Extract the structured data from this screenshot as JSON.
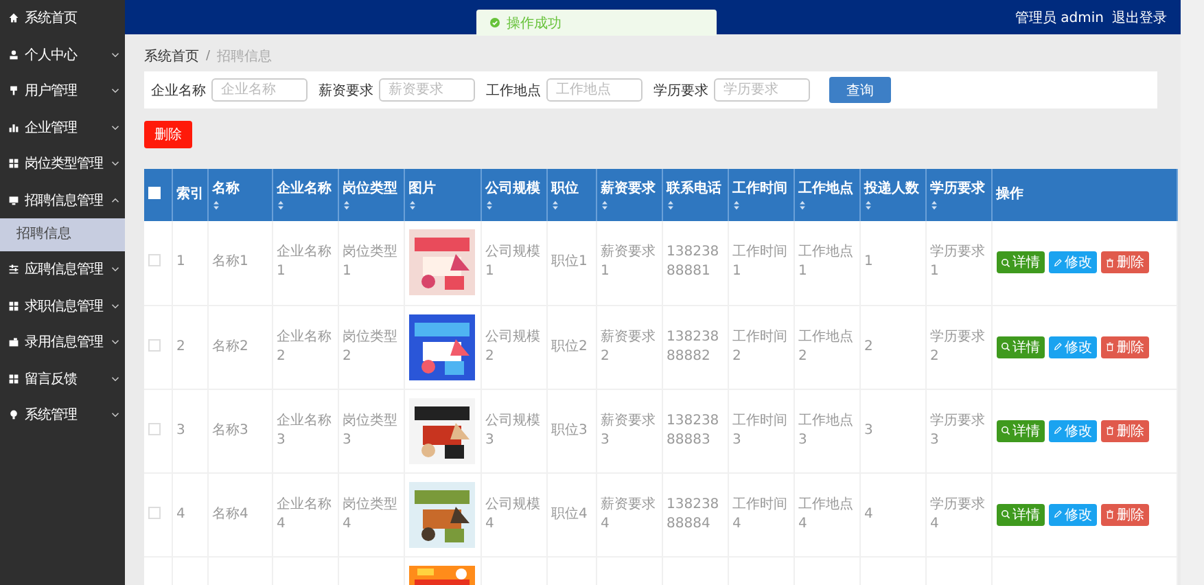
{
  "sidebar": {
    "items": [
      {
        "label": "系统首页"
      },
      {
        "label": "个人中心",
        "expanded": false
      },
      {
        "label": "用户管理",
        "expanded": false
      },
      {
        "label": "企业管理",
        "expanded": false
      },
      {
        "label": "岗位类型管理",
        "expanded": false
      },
      {
        "label": "招聘信息管理",
        "expanded": true,
        "children": [
          {
            "label": "招聘信息",
            "selected": true
          }
        ]
      },
      {
        "label": "应聘信息管理",
        "expanded": false
      },
      {
        "label": "求职信息管理",
        "expanded": false
      },
      {
        "label": "录用信息管理",
        "expanded": false
      },
      {
        "label": "留言反馈",
        "expanded": false
      },
      {
        "label": "系统管理",
        "expanded": false
      }
    ]
  },
  "header": {
    "user": "管理员 admin",
    "logout": "退出登录"
  },
  "toast": {
    "message": "操作成功"
  },
  "breadcrumb": {
    "items": [
      "系统首页",
      "招聘信息"
    ],
    "separator": "/"
  },
  "search": {
    "fields": [
      {
        "label": "企业名称",
        "placeholder": "企业名称"
      },
      {
        "label": "薪资要求",
        "placeholder": "薪资要求"
      },
      {
        "label": "工作地点",
        "placeholder": "工作地点"
      },
      {
        "label": "学历要求",
        "placeholder": "学历要求"
      }
    ],
    "button": "查询"
  },
  "delete_button": "删除",
  "table": {
    "select_all_checked": false,
    "columns": [
      {
        "label": "索引",
        "sortable": false
      },
      {
        "label": "名称",
        "sortable": true
      },
      {
        "label": "企业名称",
        "sortable": true
      },
      {
        "label": "岗位类型",
        "sortable": true
      },
      {
        "label": "图片",
        "sortable": true
      },
      {
        "label": "公司规模",
        "sortable": true
      },
      {
        "label": "职位",
        "sortable": true
      },
      {
        "label": "薪资要求",
        "sortable": true
      },
      {
        "label": "联系电话",
        "sortable": true
      },
      {
        "label": "工作时间",
        "sortable": true
      },
      {
        "label": "工作地点",
        "sortable": true
      },
      {
        "label": "投递人数",
        "sortable": true
      },
      {
        "label": "学历要求",
        "sortable": true
      },
      {
        "label": "操作",
        "sortable": false
      }
    ],
    "rows": [
      {
        "kind": "full",
        "checked": false,
        "cells": [
          "1",
          "名称1",
          "企业名称1",
          "岗位类型1",
          null,
          "公司规模1",
          "职位1",
          "薪资要求1",
          "13823888881",
          "工作时间1",
          "工作地点1",
          "1",
          "学历要求1"
        ],
        "actions": [
          {
            "kind": "detail",
            "label": "详情"
          },
          {
            "kind": "edit",
            "label": "修改"
          },
          {
            "kind": "delete",
            "label": "删除"
          }
        ]
      },
      {
        "kind": "full",
        "checked": false,
        "cells": [
          "2",
          "名称2",
          "企业名称2",
          "岗位类型2",
          null,
          "公司规模2",
          "职位2",
          "薪资要求2",
          "13823888882",
          "工作时间2",
          "工作地点2",
          "2",
          "学历要求2"
        ],
        "actions": [
          {
            "kind": "detail",
            "label": "详情"
          },
          {
            "kind": "edit",
            "label": "修改"
          },
          {
            "kind": "delete",
            "label": "删除"
          }
        ]
      },
      {
        "kind": "full",
        "checked": false,
        "cells": [
          "3",
          "名称3",
          "企业名称3",
          "岗位类型3",
          null,
          "公司规模3",
          "职位3",
          "薪资要求3",
          "13823888883",
          "工作时间3",
          "工作地点3",
          "3",
          "学历要求3"
        ],
        "actions": [
          {
            "kind": "detail",
            "label": "详情"
          },
          {
            "kind": "edit",
            "label": "修改"
          },
          {
            "kind": "delete",
            "label": "删除"
          }
        ]
      },
      {
        "kind": "full",
        "checked": false,
        "cells": [
          "4",
          "名称4",
          "企业名称4",
          "岗位类型4",
          null,
          "公司规模4",
          "职位4",
          "薪资要求4",
          "13823888884",
          "工作时间4",
          "工作地点4",
          "4",
          "学历要求4"
        ],
        "actions": [
          {
            "kind": "detail",
            "label": "详情"
          },
          {
            "kind": "edit",
            "label": "修改"
          },
          {
            "kind": "delete",
            "label": "删除"
          }
        ]
      },
      {
        "kind": "picture_only"
      }
    ]
  }
}
